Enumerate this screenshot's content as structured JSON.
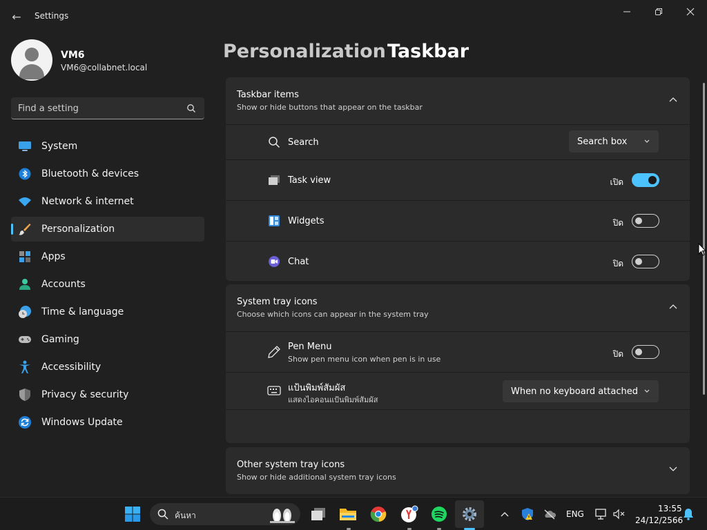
{
  "window": {
    "title": "Settings",
    "back_glyph": "←",
    "controls": [
      "minimize-icon",
      "maximize-icon",
      "close-icon"
    ]
  },
  "user": {
    "name": "VM6",
    "email": "VM6@collabnet.local"
  },
  "search": {
    "placeholder": "Find a setting",
    "value": ""
  },
  "sidebar": {
    "items": [
      {
        "label": "System",
        "icon": "system-icon"
      },
      {
        "label": "Bluetooth & devices",
        "icon": "bluetooth-icon"
      },
      {
        "label": "Network & internet",
        "icon": "wifi-icon"
      },
      {
        "label": "Personalization",
        "icon": "brush-icon",
        "active": true
      },
      {
        "label": "Apps",
        "icon": "apps-icon"
      },
      {
        "label": "Accounts",
        "icon": "accounts-icon"
      },
      {
        "label": "Time & language",
        "icon": "clock-globe-icon"
      },
      {
        "label": "Gaming",
        "icon": "gamepad-icon"
      },
      {
        "label": "Accessibility",
        "icon": "accessibility-icon"
      },
      {
        "label": "Privacy & security",
        "icon": "shield-icon"
      },
      {
        "label": "Windows Update",
        "icon": "update-icon"
      }
    ]
  },
  "breadcrumb": {
    "parent": "Personalization",
    "separator": "›",
    "current": "Taskbar"
  },
  "taskbar_items": {
    "title": "Taskbar items",
    "description": "Show or hide buttons that appear on the taskbar",
    "rows": [
      {
        "label": "Search",
        "icon": "search-icon",
        "control": "dropdown",
        "value": "Search box"
      },
      {
        "label": "Task view",
        "icon": "task-view-icon",
        "control": "toggle",
        "state": "เปิด",
        "on": true
      },
      {
        "label": "Widgets",
        "icon": "widgets-icon",
        "control": "toggle",
        "state": "ปิด",
        "on": false
      },
      {
        "label": "Chat",
        "icon": "chat-icon",
        "control": "toggle",
        "state": "ปิด",
        "on": false
      }
    ]
  },
  "system_tray_icons": {
    "title": "System tray icons",
    "description": "Choose which icons can appear in the system tray",
    "rows": [
      {
        "label": "Pen Menu",
        "sub": "Show pen menu icon when pen is in use",
        "icon": "pen-icon",
        "control": "toggle",
        "state": "ปิด",
        "on": false
      },
      {
        "label": "แป้นพิมพ์สัมผัส",
        "sub": "แสดงไอคอนแป้นพิมพ์สัมผัส",
        "icon": "keyboard-icon",
        "control": "dropdown",
        "value": "When no keyboard attached"
      }
    ]
  },
  "other_system_tray_icons": {
    "title": "Other system tray icons",
    "description": "Show or hide additional system tray icons"
  },
  "taskbar": {
    "search_label": "ค้นหา",
    "language": "ENG",
    "time": "13:55",
    "date": "24/12/2566"
  },
  "colors": {
    "accent": "#4cc2ff",
    "background": "#202020",
    "card": "#2b2b2b"
  }
}
